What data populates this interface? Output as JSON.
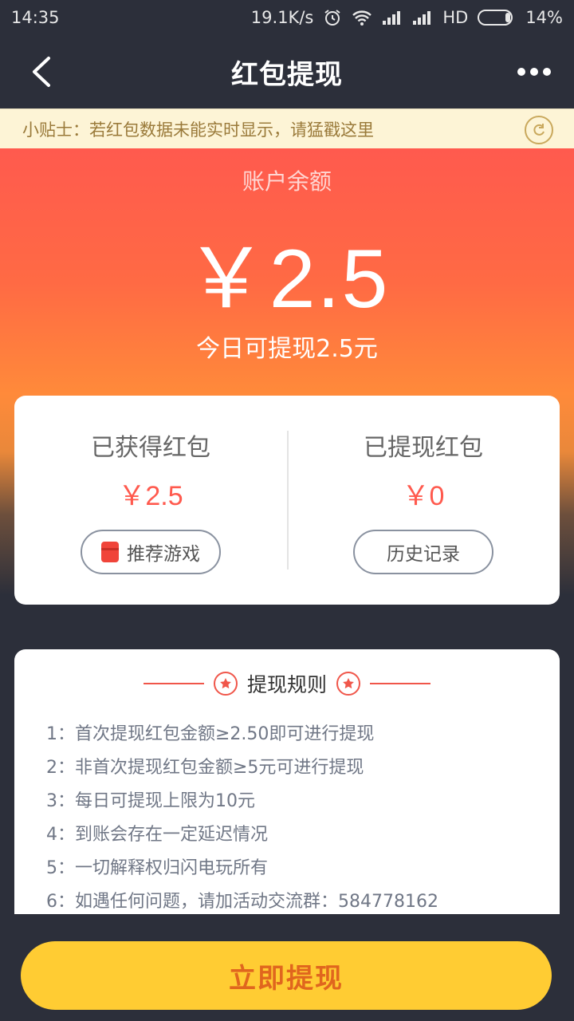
{
  "status_bar": {
    "time": "14:35",
    "net_speed": "19.1K/s",
    "network_type": "HD",
    "battery": "14%"
  },
  "header": {
    "title": "红包提现"
  },
  "tip": {
    "text": "小贴士：若红包数据未能实时显示，请猛戳这里"
  },
  "balance": {
    "label": "账户余额",
    "amount": "￥2.5",
    "today_text": "今日可提现2.5元"
  },
  "stats": {
    "earned_label": "已获得红包",
    "earned_value": "￥2.5",
    "recommend_button": "推荐游戏",
    "withdrawn_label": "已提现红包",
    "withdrawn_value": "￥0",
    "history_button": "历史记录"
  },
  "rules": {
    "title": "提现规则",
    "items": [
      "1：首次提现红包金额≥2.50即可进行提现",
      "2：非首次提现红包金额≥5元可进行提现",
      "3：每日可提现上限为10元",
      "4：到账会存在一定延迟情况",
      "5：一切解释权归闪电玩所有",
      "6：如遇任何问题，请加活动交流群：584778162"
    ]
  },
  "action": {
    "withdraw_button": "立即提现"
  },
  "colors": {
    "accent_red": "#ff5a4e",
    "button_yellow": "#ffcc33",
    "dark_bg": "#2c2f3a"
  }
}
